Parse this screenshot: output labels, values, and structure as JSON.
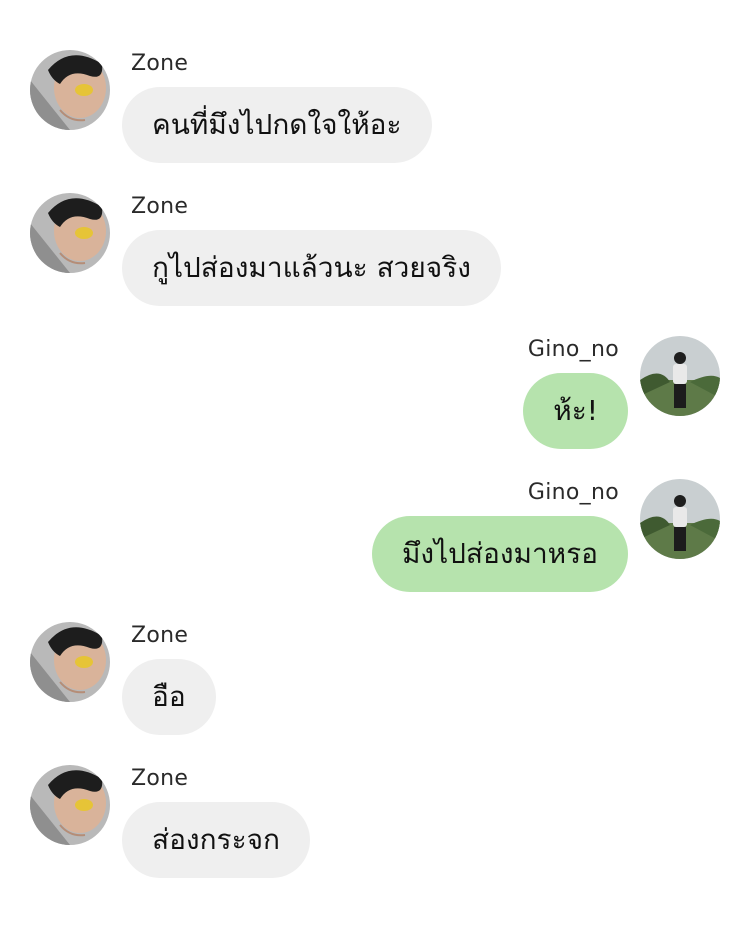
{
  "colors": {
    "incoming_bubble": "#efefef",
    "outgoing_bubble": "#b6e3ad",
    "background": "#ffffff"
  },
  "messages": [
    {
      "direction": "incoming",
      "sender": "Zone",
      "text": "คนที่มึงไปกดใจให้อะ",
      "avatar": "zone-avatar"
    },
    {
      "direction": "incoming",
      "sender": "Zone",
      "text": "กูไปส่องมาแล้วนะ สวยจริง",
      "avatar": "zone-avatar"
    },
    {
      "direction": "outgoing",
      "sender": "Gino_no",
      "text": "ห้ะ!",
      "avatar": "gino-avatar"
    },
    {
      "direction": "outgoing",
      "sender": "Gino_no",
      "text": "มึงไปส่องมาหรอ",
      "avatar": "gino-avatar"
    },
    {
      "direction": "incoming",
      "sender": "Zone",
      "text": "อือ",
      "avatar": "zone-avatar"
    },
    {
      "direction": "incoming",
      "sender": "Zone",
      "text": "ส่องกระจก",
      "avatar": "zone-avatar"
    }
  ]
}
